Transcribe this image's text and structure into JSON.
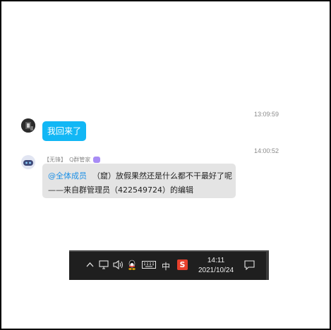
{
  "chat": {
    "messages": [
      {
        "timestamp": "13:09:59",
        "text": "我回来了"
      },
      {
        "timestamp": "14:00:52",
        "sender_tag": "【无锋】",
        "sender_name": "Q群管家",
        "mention": "@全体成员",
        "text_line1": "（窟）放假果然还是什么都不干最好了呢",
        "text_line2": "——来自群管理员（422549724）的编辑"
      }
    ]
  },
  "taskbar": {
    "ime": "中",
    "ime_app": "S",
    "time": "14:11",
    "date": "2021/10/24"
  },
  "colors": {
    "blue_bubble": "#12b7f5",
    "gray_bubble": "#e4e4e4",
    "mention": "#1d90e6",
    "taskbar_bg": "#1f1f1f",
    "ime_app_bg": "#e8402c"
  }
}
